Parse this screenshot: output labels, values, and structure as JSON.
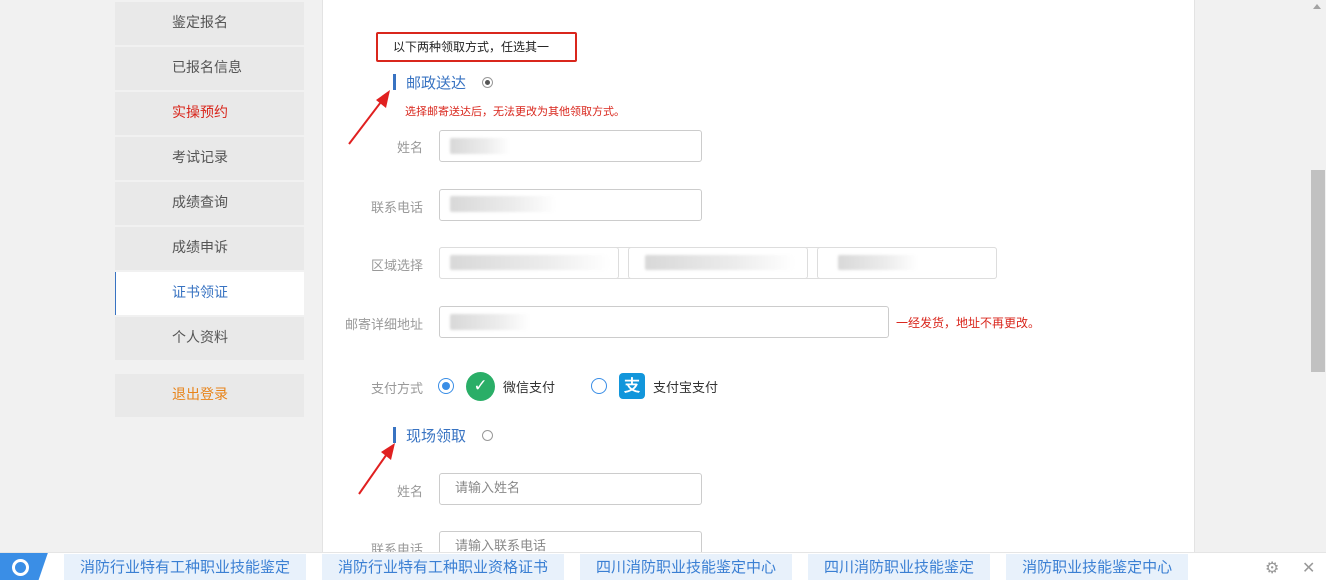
{
  "sidebar": {
    "items": [
      {
        "label": "鉴定报名"
      },
      {
        "label": "已报名信息"
      },
      {
        "label": "实操预约"
      },
      {
        "label": "考试记录"
      },
      {
        "label": "成绩查询"
      },
      {
        "label": "成绩申诉"
      },
      {
        "label": "证书领证"
      },
      {
        "label": "个人资料"
      }
    ],
    "logout": "退出登录"
  },
  "form": {
    "notice": "以下两种领取方式，任选其一",
    "postal": {
      "title": "邮政送达",
      "warning": "选择邮寄送达后，无法更改为其他领取方式。",
      "name_label": "姓名",
      "phone_label": "联系电话",
      "region_label": "区域选择",
      "address_label": "邮寄详细地址",
      "address_note": "一经发货，地址不再更改。",
      "pay_label": "支付方式",
      "pay_wechat": "微信支付",
      "pay_alipay": "支付宝支付"
    },
    "onsite": {
      "title": "现场领取",
      "name_label": "姓名",
      "name_placeholder": "请输入姓名",
      "phone_label": "联系电话",
      "phone_placeholder": "请输入联系电话"
    }
  },
  "bottom_bar": {
    "keywords": [
      "消防行业特有工种职业技能鉴定",
      "消防行业特有工种职业资格证书",
      "四川消防职业技能鉴定中心",
      "四川消防职业技能鉴定",
      "消防职业技能鉴定中心"
    ]
  },
  "colors": {
    "accent": "#3873c2",
    "warning": "#d9261c",
    "wechat": "#2aae67",
    "alipay": "#1296db"
  }
}
